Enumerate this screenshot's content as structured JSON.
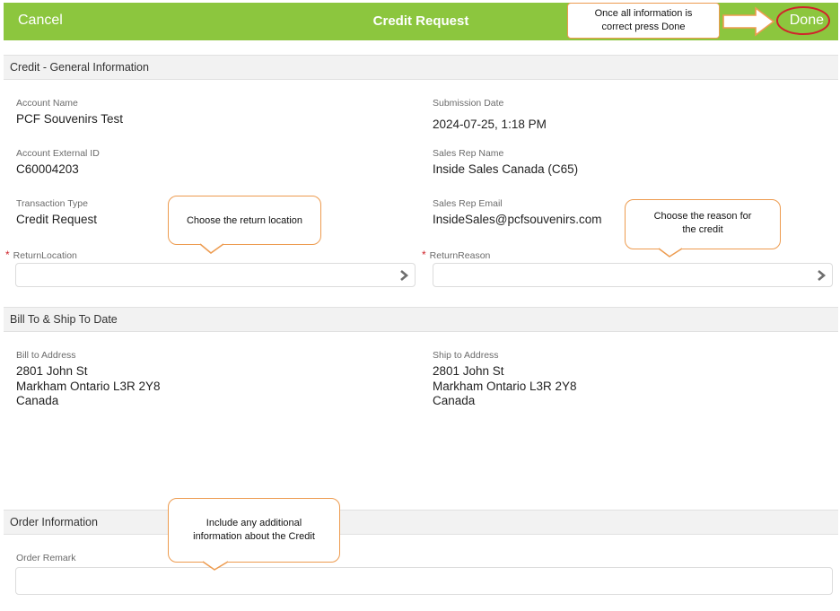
{
  "header": {
    "cancel_label": "Cancel",
    "title": "Credit Request",
    "done_label": "Done",
    "bar_color": "#8cc63e"
  },
  "general": {
    "section_title": "Credit - General Information",
    "account_name_label": "Account Name",
    "account_name": "PCF Souvenirs Test",
    "submission_date_label": "Submission Date",
    "submission_date": "2024-07-25, 1:18 PM",
    "account_external_id_label": "Account External ID",
    "account_external_id": "C60004203",
    "sales_rep_name_label": "Sales Rep Name",
    "sales_rep_name": "Inside Sales Canada (C65)",
    "transaction_type_label": "Transaction Type",
    "transaction_type": "Credit Request",
    "sales_rep_email_label": "Sales Rep Email",
    "sales_rep_email": "InsideSales@pcfsouvenirs.com",
    "required_marker": "*",
    "return_location_label": "ReturnLocation",
    "return_reason_label": "ReturnReason"
  },
  "addresses": {
    "section_title": "Bill To & Ship To Date",
    "bill_to_label": "Bill to Address",
    "bill_to_line1": "2801 John St",
    "bill_to_line2": "Markham Ontario L3R 2Y8",
    "bill_to_line3": "Canada",
    "ship_to_label": "Ship to Address",
    "ship_to_line1": "2801 John St",
    "ship_to_line2": "Markham Ontario L3R 2Y8",
    "ship_to_line3": "Canada"
  },
  "order": {
    "section_title": "Order Information",
    "order_remark_label": "Order Remark"
  },
  "annotations": {
    "done_note_line1": "Once all information is",
    "done_note_line2": "correct press Done",
    "return_location_note": "Choose the return location",
    "return_reason_note_line1": "Choose the reason for",
    "return_reason_note_line2": "the credit",
    "order_remark_note_line1": "Include any additional",
    "order_remark_note_line2": "information about the Credit",
    "accent_color": "#ed9b4f",
    "highlight_color": "#d0242b"
  }
}
